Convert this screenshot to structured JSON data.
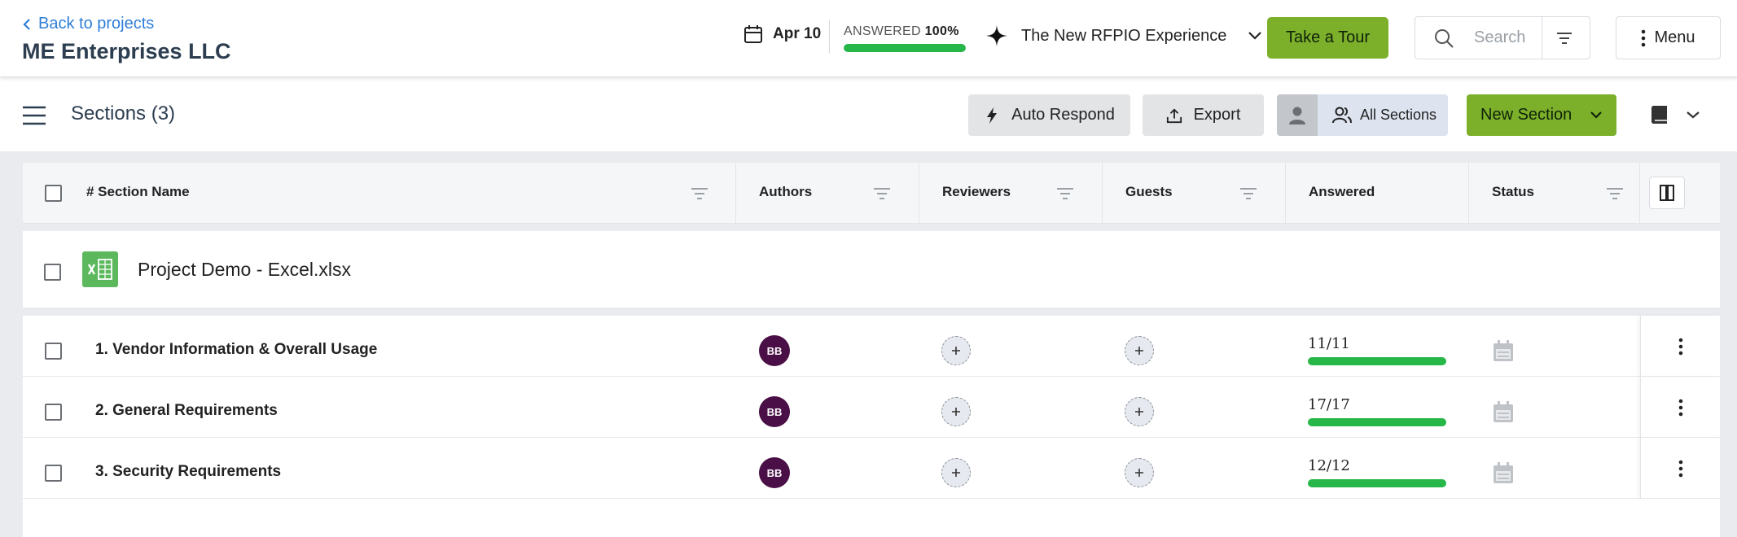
{
  "header": {
    "back_label": "Back to projects",
    "company": "ME Enterprises LLC",
    "date": "Apr 10",
    "answered_label": "ANSWERED",
    "answered_pct_label": "100%",
    "answered_pct": 100,
    "experience_label": "The New RFPIO Experience",
    "tour_label": "Take a Tour",
    "search_placeholder": "Search",
    "menu_label": "Menu"
  },
  "toolbar": {
    "sections_title": "Sections (3)",
    "auto_respond_label": "Auto Respond",
    "export_label": "Export",
    "all_sections_label": "All Sections",
    "new_section_label": "New Section"
  },
  "table": {
    "columns": [
      {
        "label": "# Section Name"
      },
      {
        "label": "Authors"
      },
      {
        "label": "Reviewers"
      },
      {
        "label": "Guests"
      },
      {
        "label": "Answered"
      },
      {
        "label": "Status"
      }
    ],
    "file": {
      "name": "Project Demo - Excel.xlsx"
    },
    "rows": [
      {
        "name": "1. Vendor Information & Overall Usage",
        "author": "BB",
        "answered": "11/11",
        "pct": 100
      },
      {
        "name": "2. General Requirements",
        "author": "BB",
        "answered": "17/17",
        "pct": 100
      },
      {
        "name": "3. Security Requirements",
        "author": "BB",
        "answered": "12/12",
        "pct": 100
      }
    ]
  },
  "colors": {
    "accent_green": "#7cb02a",
    "progress_green": "#27b648",
    "link_blue": "#2f7ed8",
    "avatar_purple": "#4a0f46"
  }
}
